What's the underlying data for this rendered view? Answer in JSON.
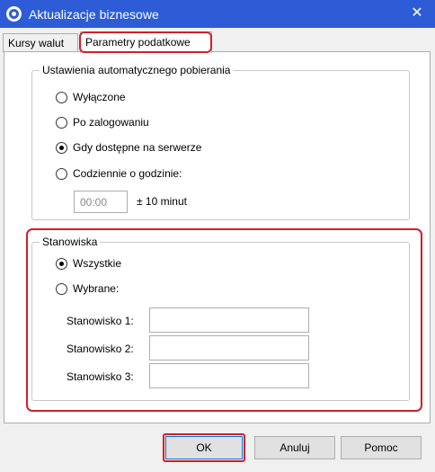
{
  "window": {
    "title": "Aktualizacje biznesowe",
    "close_glyph": "✕"
  },
  "tabs": [
    {
      "label": "Kursy walut"
    },
    {
      "label": "Parametry podatkowe",
      "selected": true
    }
  ],
  "auto_download": {
    "legend": "Ustawienia automatycznego pobierania",
    "options": [
      {
        "label": "Wyłączone",
        "checked": false
      },
      {
        "label": "Po zalogowaniu",
        "checked": false
      },
      {
        "label": "Gdy dostępne na serwerze",
        "checked": true
      },
      {
        "label": "Codziennie o godzinie:",
        "checked": false
      }
    ],
    "time_value": "00:00",
    "tolerance": "± 10 minut"
  },
  "stations": {
    "legend": "Stanowiska",
    "options": [
      {
        "label": "Wszystkie",
        "checked": true
      },
      {
        "label": "Wybrane:",
        "checked": false
      }
    ],
    "fields": [
      {
        "label": "Stanowisko 1:",
        "value": ""
      },
      {
        "label": "Stanowisko 2:",
        "value": ""
      },
      {
        "label": "Stanowisko 3:",
        "value": ""
      }
    ]
  },
  "buttons": {
    "ok": "OK",
    "cancel": "Anuluj",
    "help": "Pomoc"
  },
  "colors": {
    "titlebar": "#2e5cd6",
    "highlight": "#d0202a",
    "focus": "#0078d7"
  }
}
